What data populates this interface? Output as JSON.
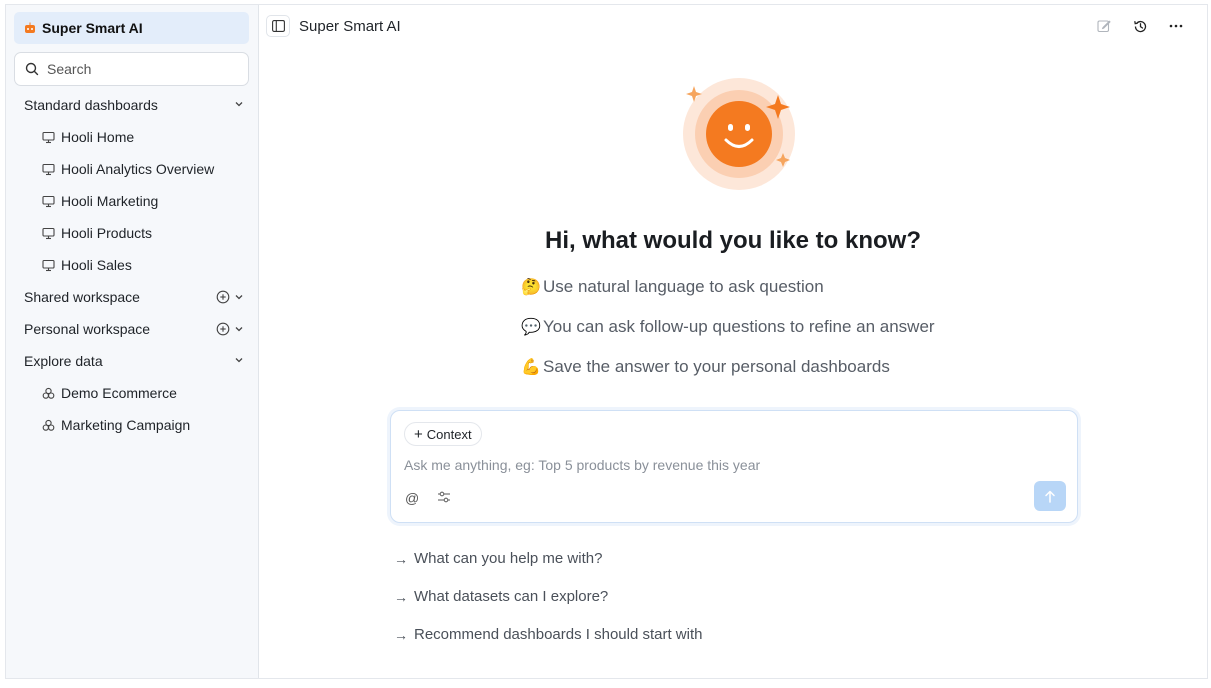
{
  "sidebar": {
    "brand": "Super Smart AI",
    "search_placeholder": "Search",
    "sections": {
      "standard": "Standard dashboards",
      "shared": "Shared workspace",
      "personal": "Personal workspace",
      "explore": "Explore data"
    },
    "dashboards": [
      "Hooli Home",
      "Hooli Analytics Overview",
      "Hooli Marketing",
      "Hooli Products",
      "Hooli Sales"
    ],
    "datasets": [
      "Demo Ecommerce",
      "Marketing Campaign"
    ]
  },
  "main": {
    "title": "Super Smart AI",
    "greeting": "Hi, what would you like to know?",
    "tips": [
      {
        "emoji": "🤔",
        "text": "Use natural language to ask question"
      },
      {
        "emoji": "💬",
        "text": "You can ask follow-up questions to refine an answer"
      },
      {
        "emoji": "💪",
        "text": "Save the answer to your personal dashboards"
      }
    ],
    "composer": {
      "context_label": "Context",
      "placeholder": "Ask me anything, eg: Top 5 products by revenue this year",
      "mention_symbol": "@"
    },
    "suggestions": [
      "What can you help me with?",
      "What datasets can I explore?",
      "Recommend dashboards I should start with"
    ]
  },
  "colors": {
    "accent": "#f47a20",
    "brand_bg": "#e3edfa",
    "send_disabled": "#b8d6f7"
  }
}
